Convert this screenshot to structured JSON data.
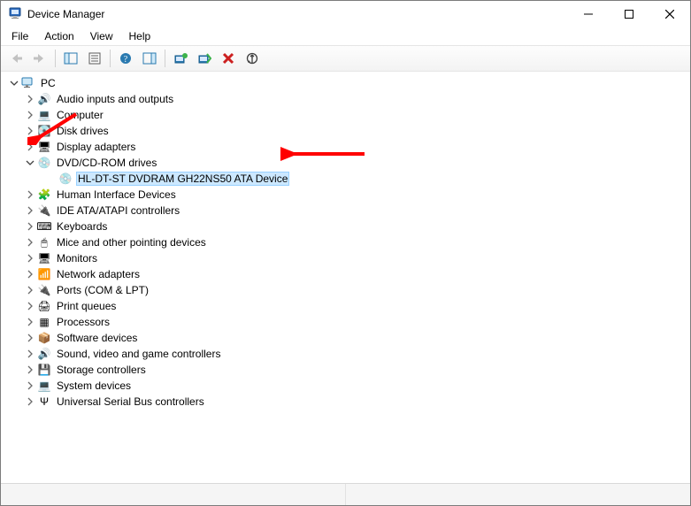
{
  "window": {
    "title": "Device Manager"
  },
  "menus": {
    "file": "File",
    "action": "Action",
    "view": "View",
    "help": "Help"
  },
  "tree": {
    "root": "PC",
    "items": [
      {
        "label": "Audio inputs and outputs",
        "icon": "🔊"
      },
      {
        "label": "Computer",
        "icon": "💻"
      },
      {
        "label": "Disk drives",
        "icon": "💽"
      },
      {
        "label": "Display adapters",
        "icon": "🖥"
      },
      {
        "label": "DVD/CD-ROM drives",
        "icon": "💿",
        "expanded": true,
        "children": [
          {
            "label": "HL-DT-ST DVDRAM GH22NS50 ATA Device",
            "icon": "💿",
            "selected": true
          }
        ]
      },
      {
        "label": "Human Interface Devices",
        "icon": "🧩"
      },
      {
        "label": "IDE ATA/ATAPI controllers",
        "icon": "🔌"
      },
      {
        "label": "Keyboards",
        "icon": "⌨"
      },
      {
        "label": "Mice and other pointing devices",
        "icon": "🖱"
      },
      {
        "label": "Monitors",
        "icon": "🖥"
      },
      {
        "label": "Network adapters",
        "icon": "📶"
      },
      {
        "label": "Ports (COM & LPT)",
        "icon": "🔌"
      },
      {
        "label": "Print queues",
        "icon": "🖨"
      },
      {
        "label": "Processors",
        "icon": "▦"
      },
      {
        "label": "Software devices",
        "icon": "📦"
      },
      {
        "label": "Sound, video and game controllers",
        "icon": "🔊"
      },
      {
        "label": "Storage controllers",
        "icon": "💾"
      },
      {
        "label": "System devices",
        "icon": "💻"
      },
      {
        "label": "Universal Serial Bus controllers",
        "icon": "Ψ"
      }
    ]
  },
  "annotations": {
    "arrow_color": "#ff0000"
  }
}
